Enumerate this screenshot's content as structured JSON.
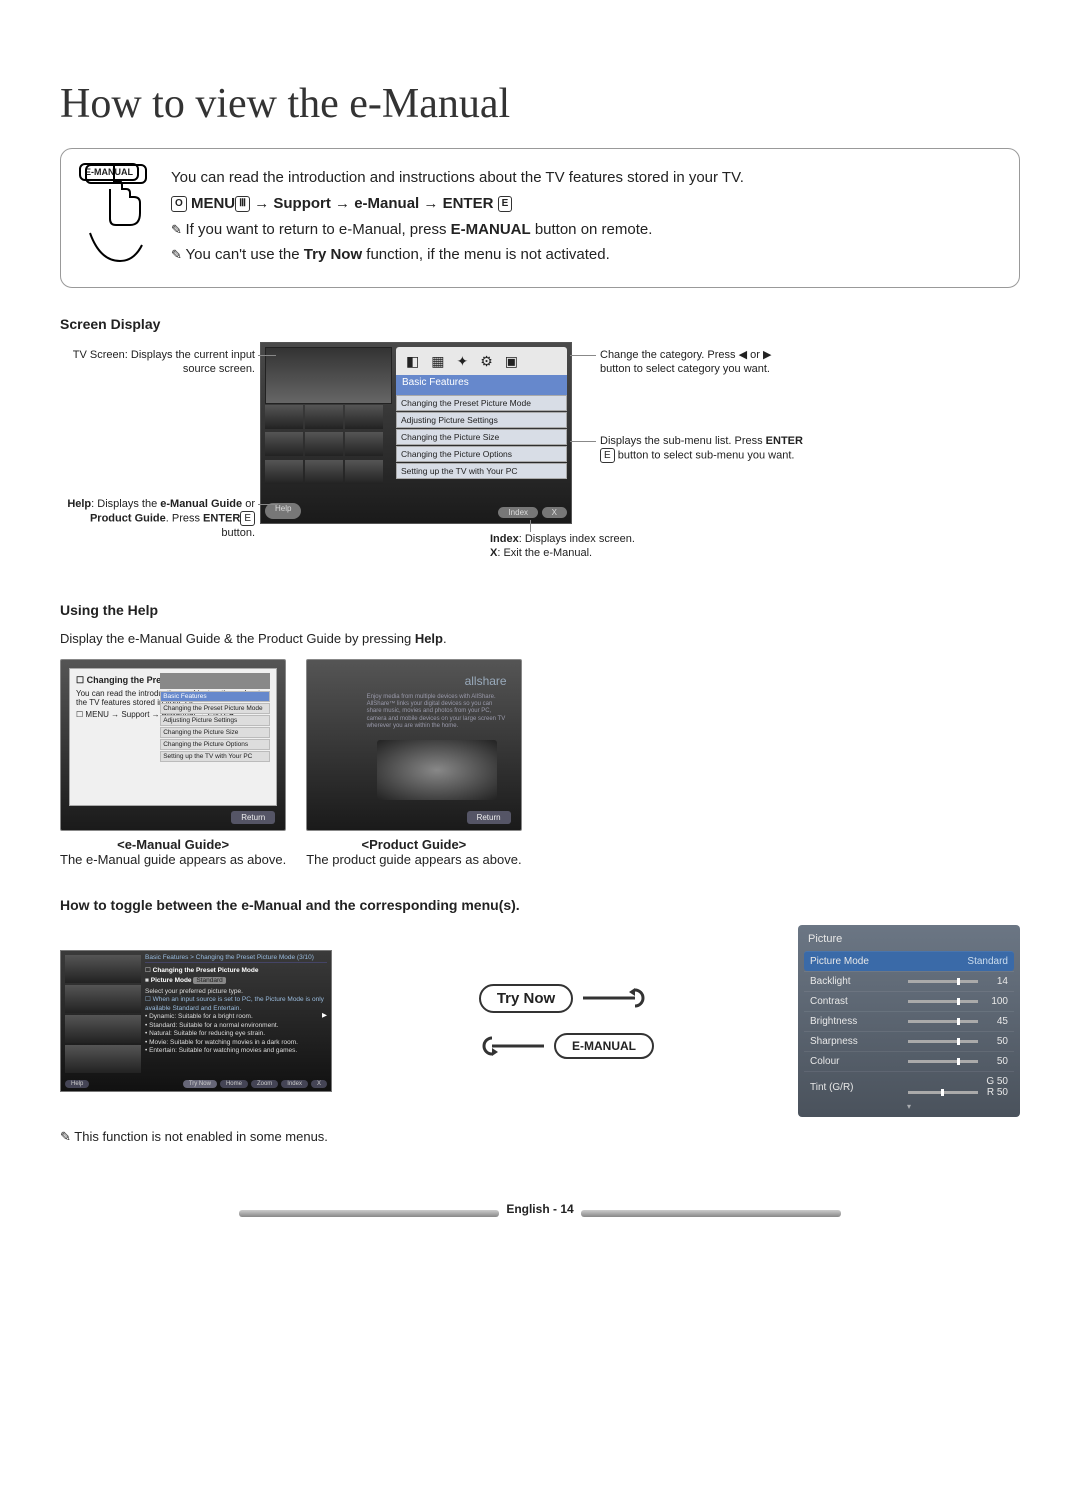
{
  "title": "How to view the e-Manual",
  "intro": {
    "badge": "E-MANUAL",
    "text": "You can read the introduction and instructions about the TV features stored in your TV.",
    "path_prefix_icon": "O",
    "path_menu": "MENU",
    "path_arrow": " → ",
    "path_support": "Support",
    "path_emanual": "e-Manual",
    "path_enter": "ENTER",
    "enter_glyph": "E",
    "note1_pre": "If you want to return to e-Manual, press ",
    "note1_bold": "E-MANUAL",
    "note1_post": " button on remote.",
    "note2_pre": "You can't use the ",
    "note2_bold": "Try Now",
    "note2_post": " function, if the menu is not activated."
  },
  "screen_display": {
    "title": "Screen Display",
    "callouts": {
      "tv": "TV Screen: Displays the current input source screen.",
      "help_pre": "Help",
      "help_mid": ": Displays the ",
      "help_b1": "e-Manual Guide",
      "help_or": " or ",
      "help_b2": "Product Guide",
      "help_post": ". Press ",
      "help_enter": "ENTER",
      "help_post2": " button.",
      "category": "Change the category. Press ◀ or ▶ button to select category you want.",
      "submenu_pre": "Displays the sub-menu list. Press ",
      "submenu_enter": "ENTER",
      "submenu_post": " button to select sub-menu you want.",
      "index_b": "Index",
      "index_t": ": Displays index screen.",
      "x_b": "X",
      "x_t": ": Exit the e-Manual."
    },
    "shot": {
      "catlabel": "Basic Features",
      "subs": [
        "Changing the Preset Picture Mode",
        "Adjusting Picture Settings",
        "Changing the Picture Size",
        "Changing the Picture Options",
        "Setting up the TV with Your PC"
      ],
      "help_btn": "Help",
      "index_btn": "Index",
      "x_btn": "X"
    }
  },
  "help": {
    "title": "Using the Help",
    "desc_pre": "Display the e-Manual Guide & the Product Guide by pressing ",
    "desc_bold": "Help",
    "desc_post": ".",
    "left_panel": {
      "ptitle": "Changing the Preset Picture Mode",
      "l1": "You can read the introduction and instructions about the TV features stored in your TV.",
      "path": "MENU → Support → e-Manual → ENTER",
      "bflabel": "Basic Features",
      "subs": [
        "Changing the Preset Picture Mode",
        "Adjusting Picture Settings",
        "Changing the Picture Size",
        "Changing the Picture Options",
        "Setting up the TV with Your PC"
      ],
      "return": "Return"
    },
    "right_panel": {
      "brand": "allshare",
      "return": "Return"
    },
    "left_caption_t": "<e-Manual Guide>",
    "left_caption_d": "The e-Manual guide appears as above.",
    "right_caption_t": "<Product Guide>",
    "right_caption_d": "The product guide appears as above."
  },
  "toggle": {
    "title": "How to toggle between the e-Manual and the corresponding menu(s).",
    "try_now": "Try Now",
    "emanual_btn": "E-MANUAL",
    "leftshot": {
      "crumb": "Basic Features > Changing the Preset Picture Mode (3/10)",
      "sub": "Changing the Preset Picture Mode",
      "pm": "Picture Mode",
      "pm_val": "Standard",
      "desc": "Select your preferred picture type.",
      "note": "When an input source is set to PC, the Picture Mode is only available Standard and Entertain.",
      "bullets": [
        "Dynamic: Suitable for a bright room.",
        "Standard: Suitable for a normal environment.",
        "Natural: Suitable for reducing eye strain.",
        "Movie: Suitable for watching movies in a dark room.",
        "Entertain: Suitable for watching movies and games."
      ],
      "buttons": [
        "Help",
        "Try Now",
        "Home",
        "Zoom",
        "Index",
        "X"
      ]
    },
    "picture": {
      "title": "Picture",
      "rows": [
        {
          "label": "Picture Mode",
          "value": "Standard",
          "sel": true,
          "slider": false
        },
        {
          "label": "Backlight",
          "value": "14",
          "slider": true
        },
        {
          "label": "Contrast",
          "value": "100",
          "slider": true
        },
        {
          "label": "Brightness",
          "value": "45",
          "slider": true
        },
        {
          "label": "Sharpness",
          "value": "50",
          "slider": true
        },
        {
          "label": "Colour",
          "value": "50",
          "slider": true
        },
        {
          "label": "Tint (G/R)",
          "value": "G 50      R 50",
          "slider": true,
          "tint": true
        }
      ]
    },
    "note": "This function is not enabled in some menus."
  },
  "footer": "English - 14"
}
